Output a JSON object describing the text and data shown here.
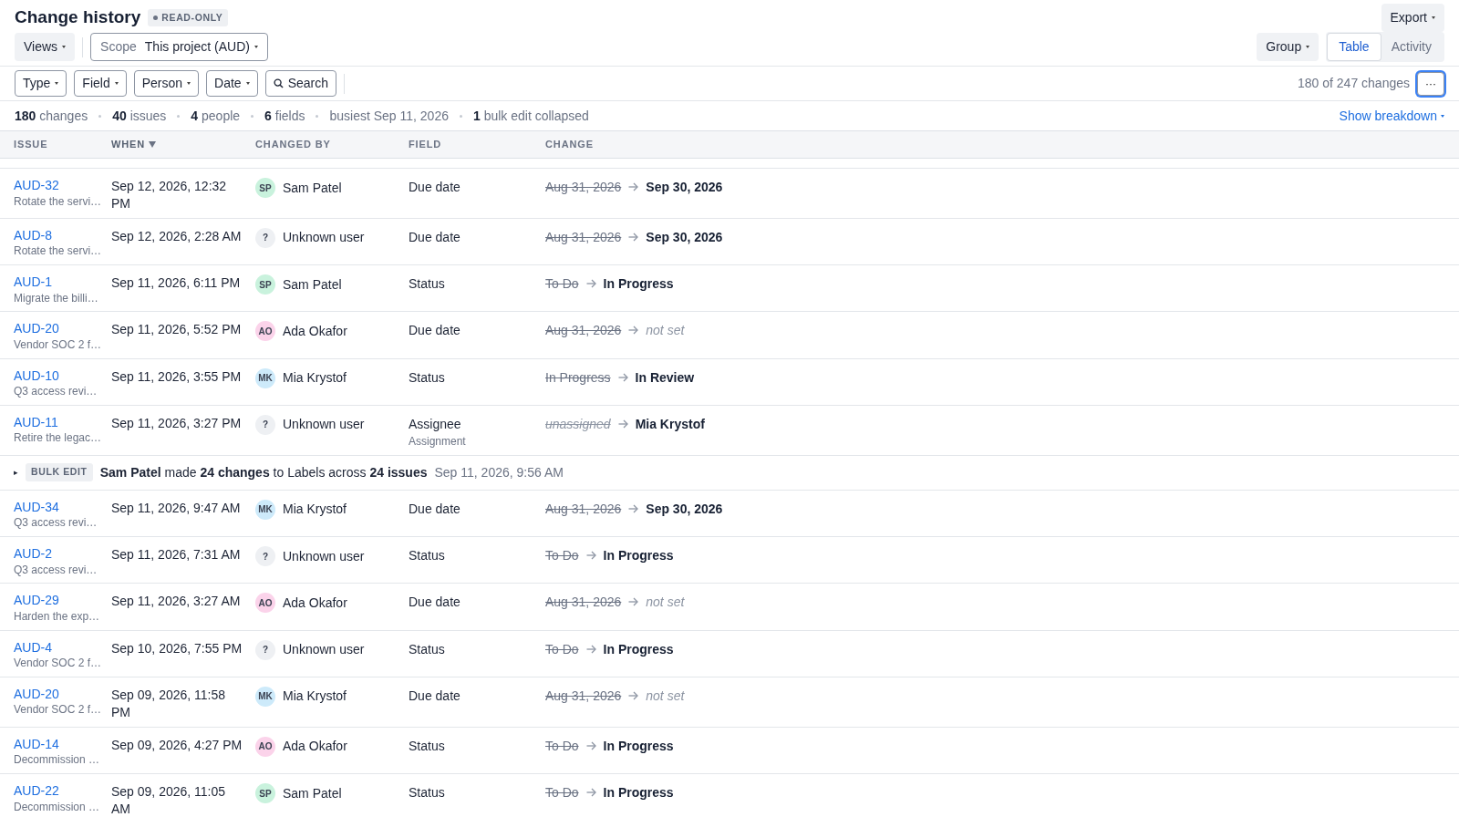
{
  "header": {
    "title": "Change history",
    "badge": "READ-ONLY",
    "export_button": "Export"
  },
  "toolbar": {
    "views_button": "Views",
    "scope": {
      "label": "Scope",
      "value": "This project (AUD)"
    },
    "group_button": "Group",
    "tabs": [
      {
        "label": "Table",
        "selected": true
      },
      {
        "label": "Activity",
        "selected": false
      }
    ]
  },
  "filters": {
    "buttons": [
      {
        "label": "Type",
        "kind": "dropdown"
      },
      {
        "label": "Field",
        "kind": "dropdown"
      },
      {
        "label": "Person",
        "kind": "dropdown"
      },
      {
        "label": "Date",
        "kind": "dropdown"
      },
      {
        "label": "Search",
        "kind": "search"
      }
    ],
    "count": "180 of 247 changes",
    "more_button": "···"
  },
  "stats": {
    "items": [
      "**180** changes",
      "**40** issues",
      "**4** people",
      "**6** fields",
      "busiest Sep 11, 2026",
      "**1** bulk edit collapsed"
    ],
    "breakdown_link": "Show breakdown"
  },
  "table": {
    "columns": [
      {
        "label": "ISSUE",
        "sorted": false
      },
      {
        "label": "WHEN",
        "sorted": true
      },
      {
        "label": "CHANGED BY",
        "sorted": false
      },
      {
        "label": "FIELD",
        "sorted": false
      },
      {
        "label": "CHANGE",
        "sorted": false
      }
    ],
    "rows": [
      {
        "kind": "change",
        "issue": "AUD-32",
        "title": "Rotate the servi…",
        "when": "Sep 12, 2026, 12:32 PM",
        "person": {
          "initials": "SP",
          "name": "Sam Patel",
          "color": "#c9f2dd"
        },
        "field": "Due date",
        "from": "Aug 31, 2026",
        "from_empty": false,
        "to": "Sep 30, 2026",
        "to_empty": false
      },
      {
        "kind": "change",
        "issue": "AUD-8",
        "title": "Rotate the servi…",
        "when": "Sep 12, 2026, 2:28 AM",
        "person": {
          "initials": "?",
          "name": "Unknown user",
          "color": "#eef0f3"
        },
        "field": "Due date",
        "from": "Aug 31, 2026",
        "from_empty": false,
        "to": "Sep 30, 2026",
        "to_empty": false
      },
      {
        "kind": "change",
        "issue": "AUD-1",
        "title": "Migrate the billi…",
        "when": "Sep 11, 2026, 6:11 PM",
        "person": {
          "initials": "SP",
          "name": "Sam Patel",
          "color": "#c9f2dd"
        },
        "field": "Status",
        "from": "To Do",
        "from_empty": false,
        "to": "In Progress",
        "to_empty": false
      },
      {
        "kind": "change",
        "issue": "AUD-20",
        "title": "Vendor SOC 2 f…",
        "when": "Sep 11, 2026, 5:52 PM",
        "person": {
          "initials": "AO",
          "name": "Ada Okafor",
          "color": "#fbd3ea"
        },
        "field": "Due date",
        "from": "Aug 31, 2026",
        "from_empty": false,
        "to": "not set",
        "to_empty": true
      },
      {
        "kind": "change",
        "issue": "AUD-10",
        "title": "Q3 access revi…",
        "when": "Sep 11, 2026, 3:55 PM",
        "person": {
          "initials": "MK",
          "name": "Mia Krystof",
          "color": "#cdeafa"
        },
        "field": "Status",
        "from": "In Progress",
        "from_empty": false,
        "to": "In Review",
        "to_empty": false
      },
      {
        "kind": "change",
        "issue": "AUD-11",
        "title": "Retire the legac…",
        "when": "Sep 11, 2026, 3:27 PM",
        "person": {
          "initials": "?",
          "name": "Unknown user",
          "color": "#eef0f3"
        },
        "field": "Assignee",
        "field_note": "Assignment",
        "from": "unassigned",
        "from_empty": true,
        "to": "Mia Krystof",
        "to_empty": false
      },
      {
        "kind": "bulk",
        "caret": "▸",
        "badge": "BULK EDIT",
        "summary": "**Sam Patel** made **24 changes** to Labels across **24 issues**",
        "timestamp": "Sep 11, 2026, 9:56 AM"
      },
      {
        "kind": "change",
        "issue": "AUD-34",
        "title": "Q3 access revi…",
        "when": "Sep 11, 2026, 9:47 AM",
        "person": {
          "initials": "MK",
          "name": "Mia Krystof",
          "color": "#cdeafa"
        },
        "field": "Due date",
        "from": "Aug 31, 2026",
        "from_empty": false,
        "to": "Sep 30, 2026",
        "to_empty": false
      },
      {
        "kind": "change",
        "issue": "AUD-2",
        "title": "Q3 access revi…",
        "when": "Sep 11, 2026, 7:31 AM",
        "person": {
          "initials": "?",
          "name": "Unknown user",
          "color": "#eef0f3"
        },
        "field": "Status",
        "from": "To Do",
        "from_empty": false,
        "to": "In Progress",
        "to_empty": false
      },
      {
        "kind": "change",
        "issue": "AUD-29",
        "title": "Harden the exp…",
        "when": "Sep 11, 2026, 3:27 AM",
        "person": {
          "initials": "AO",
          "name": "Ada Okafor",
          "color": "#fbd3ea"
        },
        "field": "Due date",
        "from": "Aug 31, 2026",
        "from_empty": false,
        "to": "not set",
        "to_empty": true
      },
      {
        "kind": "change",
        "issue": "AUD-4",
        "title": "Vendor SOC 2 f…",
        "when": "Sep 10, 2026, 7:55 PM",
        "person": {
          "initials": "?",
          "name": "Unknown user",
          "color": "#eef0f3"
        },
        "field": "Status",
        "from": "To Do",
        "from_empty": false,
        "to": "In Progress",
        "to_empty": false
      },
      {
        "kind": "change",
        "issue": "AUD-20",
        "title": "Vendor SOC 2 f…",
        "when": "Sep 09, 2026, 11:58 PM",
        "person": {
          "initials": "MK",
          "name": "Mia Krystof",
          "color": "#cdeafa"
        },
        "field": "Due date",
        "from": "Aug 31, 2026",
        "from_empty": false,
        "to": "not set",
        "to_empty": true
      },
      {
        "kind": "change",
        "issue": "AUD-14",
        "title": "Decommission …",
        "when": "Sep 09, 2026, 4:27 PM",
        "person": {
          "initials": "AO",
          "name": "Ada Okafor",
          "color": "#fbd3ea"
        },
        "field": "Status",
        "from": "To Do",
        "from_empty": false,
        "to": "In Progress",
        "to_empty": false
      },
      {
        "kind": "change",
        "issue": "AUD-22",
        "title": "Decommission …",
        "when": "Sep 09, 2026, 11:05 AM",
        "person": {
          "initials": "SP",
          "name": "Sam Patel",
          "color": "#c9f2dd"
        },
        "field": "Status",
        "from": "To Do",
        "from_empty": false,
        "to": "In Progress",
        "to_empty": false
      }
    ]
  }
}
